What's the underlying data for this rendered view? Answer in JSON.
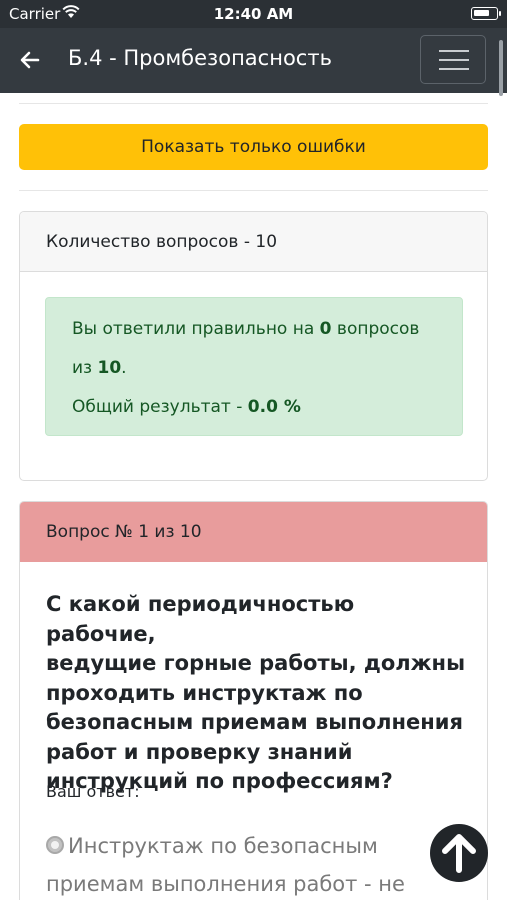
{
  "status_bar": {
    "carrier": "Carrier",
    "time": "12:40 AM"
  },
  "navbar": {
    "title": "Б.4 - Промбезопасность",
    "back_icon": "arrow-left-icon",
    "menu_icon": "hamburger-icon"
  },
  "filter_button": {
    "label": "Показать только ошибки",
    "color": "#ffc107"
  },
  "summary": {
    "header": "Количество вопросов - 10",
    "line1_prefix": "Вы ответили правильно на ",
    "correct": "0",
    "line1_suffix": " вопросов",
    "line2_prefix": "из ",
    "total": "10",
    "line2_suffix": ".",
    "line3_prefix": "Общий результат - ",
    "result": "0.0 %",
    "alert_color": "#d4edda"
  },
  "question": {
    "header": "Вопрос № 1 из 10",
    "header_color": "#e89c9c",
    "lines": [
      "С какой периодичностью рабочие,",
      "ведущие горные работы, должны",
      "проходить инструктаж по",
      "безопасным приемам выполнения",
      "работ и проверку знаний",
      "инструкций по профессиям?"
    ],
    "answer_label": "Ваш ответ:",
    "option_line1": "Инструктаж по безопасным",
    "option_line2": "приемам выполнения работ - не"
  },
  "scroll_top_icon": "arrow-up-icon"
}
